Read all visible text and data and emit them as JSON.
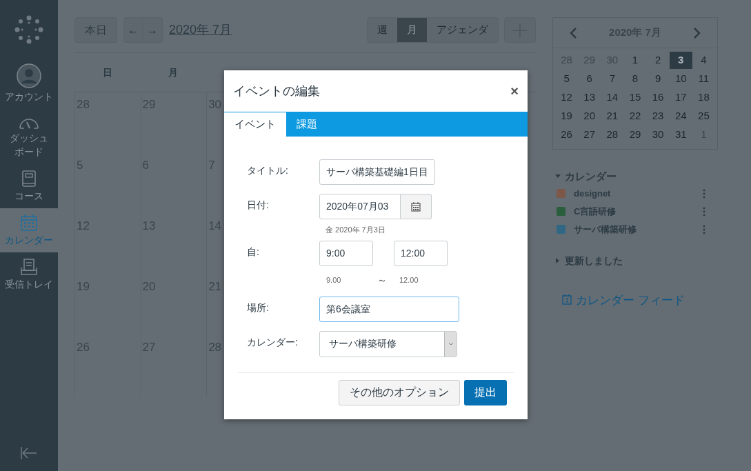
{
  "sidebar": {
    "items": [
      {
        "kind": "account",
        "label": "アカウント",
        "selected": false
      },
      {
        "kind": "dashboard",
        "label": "ダッシュボード",
        "selected": false
      },
      {
        "kind": "courses",
        "label": "コース",
        "selected": false
      },
      {
        "kind": "calendar",
        "label": "カレンダー",
        "selected": true
      },
      {
        "kind": "inbox",
        "label": "受信トレイ",
        "selected": false
      }
    ]
  },
  "toolbar": {
    "today": "本日",
    "prev": "←",
    "next": "→",
    "month": "2020年 7月",
    "views": [
      {
        "label": "週",
        "selected": false
      },
      {
        "label": "月",
        "selected": true
      },
      {
        "label": "アジェンダ",
        "selected": false
      }
    ]
  },
  "calendar": {
    "weekdays": [
      "日",
      "月"
    ],
    "weeks": [
      [
        "28",
        "29",
        "30"
      ],
      [
        "5",
        "6",
        "7"
      ],
      [
        "12",
        "13",
        "14"
      ],
      [
        "19",
        "20",
        "21"
      ],
      [
        "26",
        "27",
        "28"
      ]
    ]
  },
  "mini_calendar": {
    "title": "2020年 7月",
    "days": [
      {
        "label": "28",
        "muted": true,
        "selected": false
      },
      {
        "label": "29",
        "muted": true,
        "selected": false
      },
      {
        "label": "30",
        "muted": true,
        "selected": false
      },
      {
        "label": "1",
        "muted": false,
        "selected": false
      },
      {
        "label": "2",
        "muted": false,
        "selected": false
      },
      {
        "label": "3",
        "muted": false,
        "selected": true
      },
      {
        "label": "4",
        "muted": false,
        "selected": false
      },
      {
        "label": "5",
        "muted": false,
        "selected": false
      },
      {
        "label": "6",
        "muted": false,
        "selected": false
      },
      {
        "label": "7",
        "muted": false,
        "selected": false
      },
      {
        "label": "8",
        "muted": false,
        "selected": false
      },
      {
        "label": "9",
        "muted": false,
        "selected": false
      },
      {
        "label": "10",
        "muted": false,
        "selected": false
      },
      {
        "label": "11",
        "muted": false,
        "selected": false
      },
      {
        "label": "12",
        "muted": false,
        "selected": false
      },
      {
        "label": "13",
        "muted": false,
        "selected": false
      },
      {
        "label": "14",
        "muted": false,
        "selected": false
      },
      {
        "label": "15",
        "muted": false,
        "selected": false
      },
      {
        "label": "16",
        "muted": false,
        "selected": false
      },
      {
        "label": "17",
        "muted": false,
        "selected": false
      },
      {
        "label": "18",
        "muted": false,
        "selected": false
      },
      {
        "label": "19",
        "muted": false,
        "selected": false
      },
      {
        "label": "20",
        "muted": false,
        "selected": false
      },
      {
        "label": "21",
        "muted": false,
        "selected": false
      },
      {
        "label": "22",
        "muted": false,
        "selected": false
      },
      {
        "label": "23",
        "muted": false,
        "selected": false
      },
      {
        "label": "24",
        "muted": false,
        "selected": false
      },
      {
        "label": "25",
        "muted": false,
        "selected": false
      },
      {
        "label": "26",
        "muted": false,
        "selected": false
      },
      {
        "label": "27",
        "muted": false,
        "selected": false
      },
      {
        "label": "28",
        "muted": false,
        "selected": false
      },
      {
        "label": "29",
        "muted": false,
        "selected": false
      },
      {
        "label": "30",
        "muted": false,
        "selected": false
      },
      {
        "label": "31",
        "muted": false,
        "selected": false
      },
      {
        "label": "1",
        "muted": true,
        "selected": false
      }
    ]
  },
  "calendars": {
    "title": "カレンダー",
    "expanded": true,
    "items": [
      {
        "name": "designet",
        "color": "#7d5848"
      },
      {
        "name": "C言語研修",
        "color": "#2b5e3c"
      },
      {
        "name": "サーバ構築研修",
        "color": "#2f6785"
      }
    ]
  },
  "updated": {
    "title": "更新しました",
    "expanded": false
  },
  "feed_link": "カレンダー フィード",
  "dialog": {
    "title": "イベントの編集",
    "close": "×",
    "tabs": [
      {
        "label": "イベント",
        "selected": true
      },
      {
        "label": "課題",
        "selected": false
      }
    ],
    "fields": [
      {
        "kind": "text",
        "label": "タイトル:",
        "value": "サーバ構築基礎編1日目",
        "focused": false
      },
      {
        "kind": "date",
        "label": "日付:",
        "value": "2020年07月03",
        "hint": "金 2020年 7月3日",
        "focused": false
      },
      {
        "kind": "time",
        "label": "自:",
        "start": "9:00",
        "end": "12:00",
        "start_hint": "9.00",
        "separator": "～",
        "end_hint": "12.00"
      },
      {
        "kind": "text",
        "label": "場所:",
        "value": "第6会議室",
        "focused": true
      },
      {
        "kind": "select",
        "label": "カレンダー:",
        "value": "サーバ構築研修"
      }
    ],
    "buttons": [
      {
        "label": "その他のオプション",
        "primary": false
      },
      {
        "label": "提出",
        "primary": true
      }
    ]
  }
}
